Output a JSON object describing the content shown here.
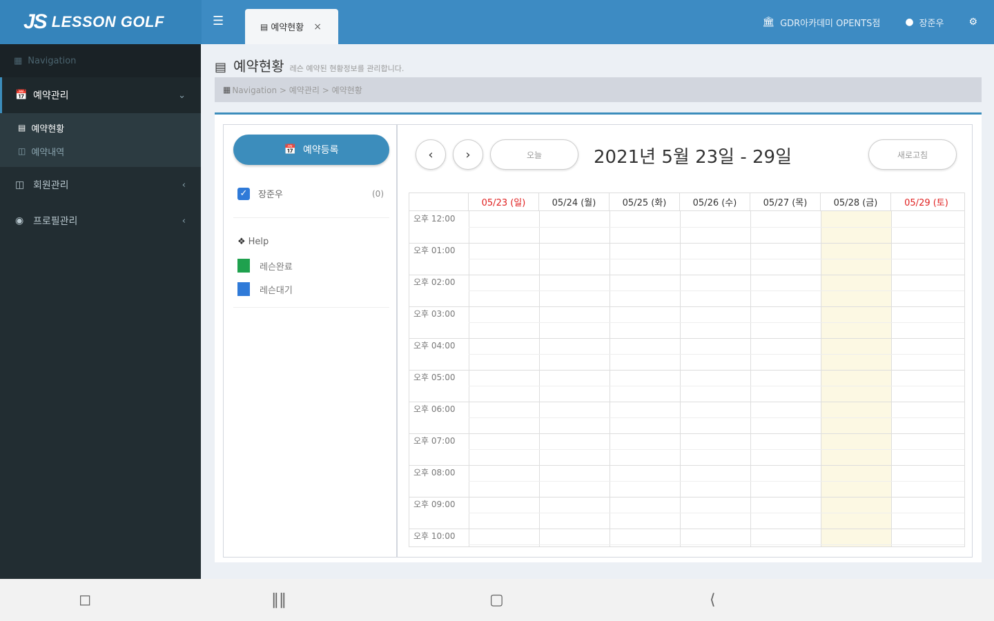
{
  "header": {
    "logo_mark": "JS",
    "logo_text": "LESSON GOLF",
    "menu_icon": "hamburger-icon",
    "tab": {
      "icon": "calendar-list-icon",
      "label": "예약현황",
      "close": "×"
    },
    "academy": "GDR아카데미 OPENTS점",
    "user": "장준우",
    "settings_icon": "gears-icon"
  },
  "sidebar": {
    "nav_header": "Navigation",
    "menu": [
      {
        "label": "예약관리",
        "icon": "calendar-icon",
        "chevron": "⌄",
        "active": true
      },
      {
        "label": "회원관리",
        "icon": "database-icon",
        "chevron": "‹"
      },
      {
        "label": "프로필관리",
        "icon": "user-circle-icon",
        "chevron": "‹"
      }
    ],
    "submenu": [
      {
        "label": "예약현황",
        "icon": "calendar-list-icon",
        "active": true
      },
      {
        "label": "예약내역",
        "icon": "database-icon"
      }
    ]
  },
  "page": {
    "title": "예약현황",
    "subtitle": "레슨 예약된 현황정보를 관리합니다.",
    "breadcrumb": "Navigation > 예약관리 > 예약현황"
  },
  "left_panel": {
    "register_button": "예약등록",
    "instructor": {
      "name": "장준우",
      "count": "(0)",
      "checked": true
    },
    "help_title": "Help",
    "legend": [
      {
        "label": "레슨완료",
        "color": "#1fa14e"
      },
      {
        "label": "레슨대기",
        "color": "#2f7ad8"
      }
    ]
  },
  "calendar": {
    "prev": "‹",
    "next": "›",
    "today_button": "오늘",
    "range_title": "2021년 5월 23일 - 29일",
    "refresh_button": "새로고침",
    "days": [
      {
        "label": "05/23 (일)",
        "red": true
      },
      {
        "label": "05/24 (월)",
        "red": false
      },
      {
        "label": "05/25 (화)",
        "red": false
      },
      {
        "label": "05/26 (수)",
        "red": false
      },
      {
        "label": "05/27 (목)",
        "red": false
      },
      {
        "label": "05/28 (금)",
        "red": false,
        "today": true
      },
      {
        "label": "05/29 (토)",
        "red": true
      }
    ],
    "times": [
      "오후 12:00",
      "오후 01:00",
      "오후 02:00",
      "오후 03:00",
      "오후 04:00",
      "오후 05:00",
      "오후 06:00",
      "오후 07:00",
      "오후 08:00",
      "오후 09:00",
      "오후 10:00"
    ],
    "today_highlight": "#fcf8e3"
  },
  "android_nav": {
    "screenshot_icon": "screen-capture-icon",
    "recents_icon": "recents-icon",
    "home_icon": "home-icon",
    "back_icon": "back-icon"
  },
  "colors": {
    "primary": "#3c8dbc",
    "sidebar": "#222d32",
    "red_day": "#e02020"
  }
}
